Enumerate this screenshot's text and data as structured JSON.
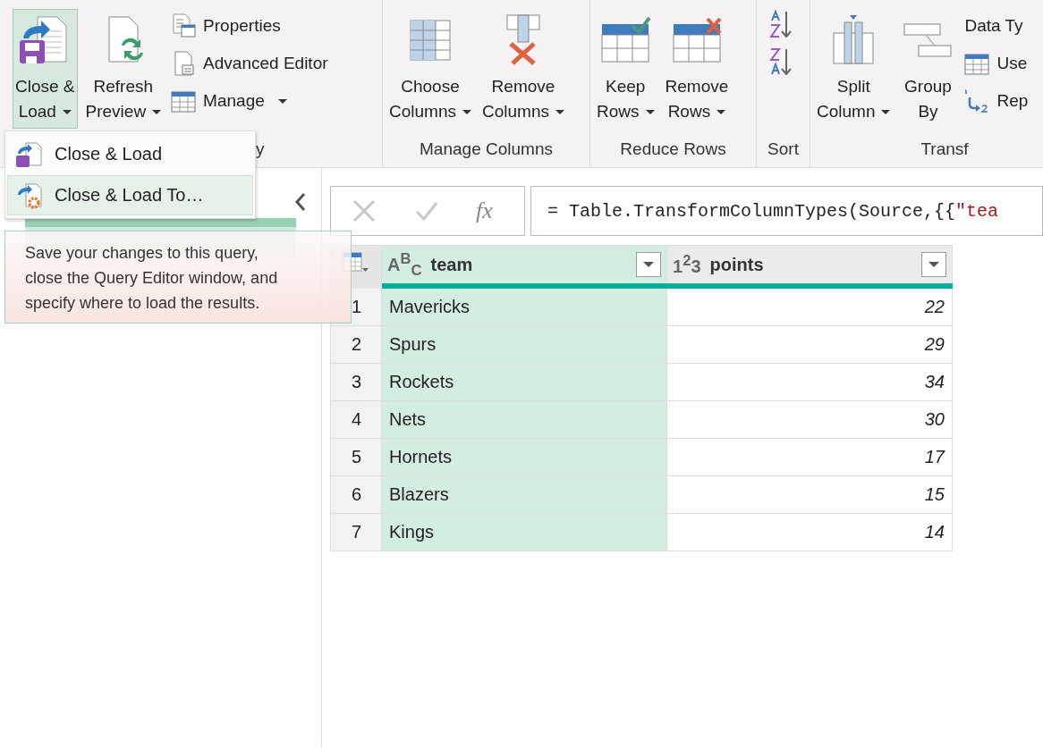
{
  "ribbon": {
    "groups": [
      {
        "label": "y",
        "items": [
          {
            "kind": "large",
            "lines": [
              "Close &",
              "Load"
            ],
            "dropdown": true,
            "selected": true
          },
          {
            "kind": "large",
            "lines": [
              "Refresh",
              "Preview"
            ],
            "dropdown": true,
            "selected": false
          },
          {
            "kind": "stack",
            "items": [
              {
                "label": "Properties",
                "dropdown": false
              },
              {
                "label": "Advanced Editor",
                "dropdown": false
              },
              {
                "label": "Manage",
                "dropdown": true
              }
            ]
          }
        ]
      },
      {
        "label": "Manage Columns",
        "items": [
          {
            "kind": "large",
            "lines": [
              "Choose",
              "Columns"
            ],
            "dropdown": true,
            "selected": false
          },
          {
            "kind": "large",
            "lines": [
              "Remove",
              "Columns"
            ],
            "dropdown": true,
            "selected": false
          }
        ]
      },
      {
        "label": "Reduce Rows",
        "items": [
          {
            "kind": "large",
            "lines": [
              "Keep",
              "Rows"
            ],
            "dropdown": true,
            "selected": false
          },
          {
            "kind": "large",
            "lines": [
              "Remove",
              "Rows"
            ],
            "dropdown": true,
            "selected": false
          }
        ]
      },
      {
        "label": "Sort",
        "items": [
          {
            "kind": "sort"
          }
        ]
      },
      {
        "label": "Transf",
        "items": [
          {
            "kind": "large",
            "lines": [
              "Split",
              "Column"
            ],
            "dropdown": true,
            "selected": false
          },
          {
            "kind": "large",
            "lines": [
              "Group",
              "By"
            ],
            "dropdown": false,
            "selected": false
          },
          {
            "kind": "stack",
            "items": [
              {
                "label": "Data Ty",
                "dropdown": false
              },
              {
                "label": "Use",
                "dropdown": false
              },
              {
                "label": "Rep",
                "dropdown": false
              }
            ]
          }
        ]
      }
    ]
  },
  "menu": [
    {
      "label": "Close & Load",
      "selected": false
    },
    {
      "label": "Close & Load To…",
      "selected": true
    }
  ],
  "tooltip": "Save your changes to this query,\nclose the Query Editor window, and\nspecify where to load the results.",
  "queries": [
    {
      "selected": true
    }
  ],
  "formula": {
    "fx": "fx",
    "code": "= Table.TransformColumnTypes(Source,{{",
    "string": "\"tea"
  },
  "table": {
    "columns": [
      {
        "type": "A$^{B}$$_{C}$",
        "name": "team",
        "selected": true
      },
      {
        "type": "1$^{2}$3",
        "name": "points",
        "selected": false
      }
    ],
    "rows": [
      {
        "index": "1",
        "team": "Mavericks",
        "points": "22"
      },
      {
        "index": "2",
        "team": "Spurs",
        "points": "29"
      },
      {
        "index": "3",
        "team": "Rockets",
        "points": "34"
      },
      {
        "index": "4",
        "team": "Nets",
        "points": "30"
      },
      {
        "index": "5",
        "team": "Hornets",
        "points": "17"
      },
      {
        "index": "6",
        "team": "Blazers",
        "points": "15"
      },
      {
        "index": "7",
        "team": "Kings",
        "points": "14"
      }
    ]
  }
}
